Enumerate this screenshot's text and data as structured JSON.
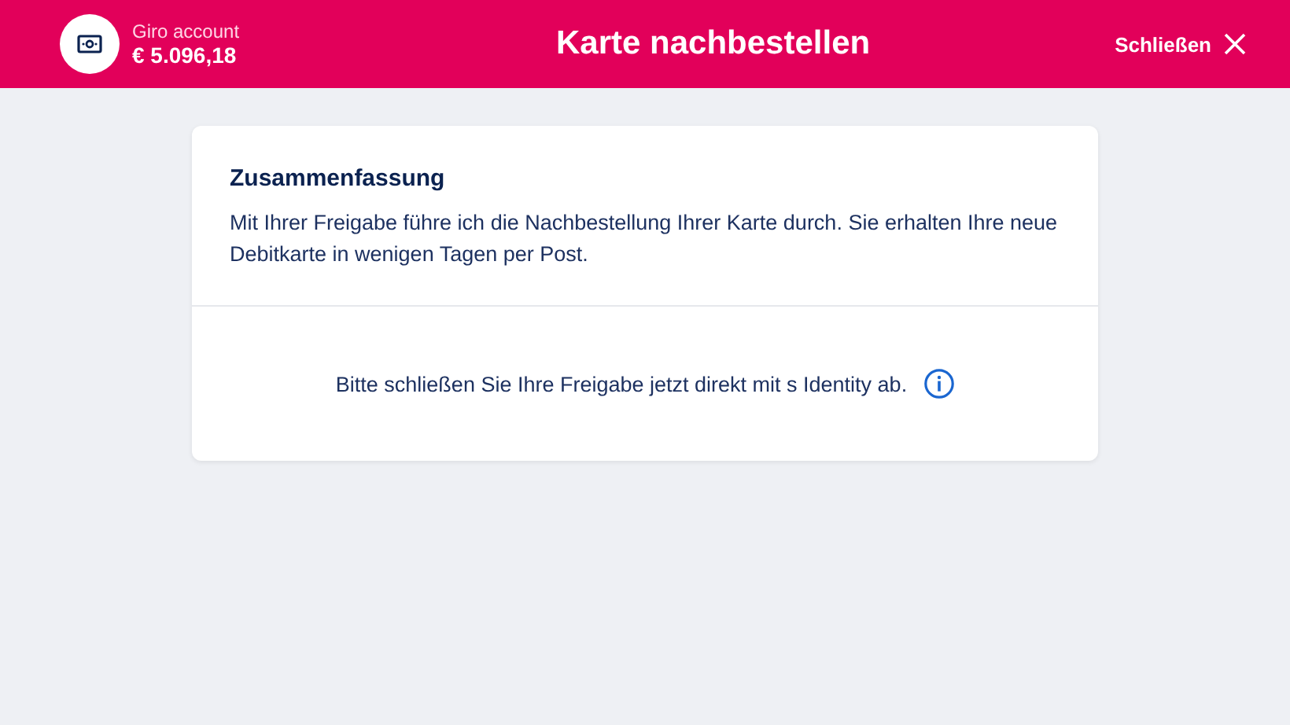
{
  "header": {
    "account_label": "Giro account",
    "account_balance": "€ 5.096,18",
    "title": "Karte nachbestellen",
    "close_label": "Schließen"
  },
  "summary": {
    "heading": "Zusammenfassung",
    "text": "Mit Ihrer Freigabe führe ich die Nachbestellung Ihrer Karte durch. Sie erhalten Ihre neue Debitkarte in wenigen Tagen per Post."
  },
  "approval": {
    "text": "Bitte schließen Sie Ihre Freigabe jetzt direkt mit s Identity ab."
  }
}
